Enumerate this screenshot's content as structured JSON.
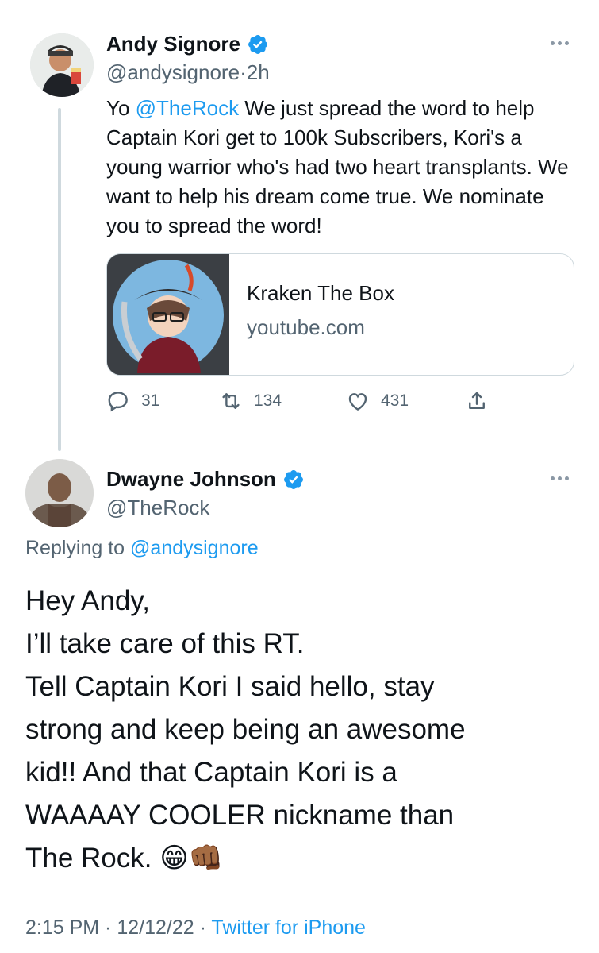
{
  "tweet1": {
    "display_name": "Andy Signore",
    "handle": "@andysignore",
    "separator": "·",
    "time": "2h",
    "text_parts": {
      "prefix": "Yo ",
      "mention": "@TheRock",
      "rest": " We just spread the word to help  Captain Kori get to 100k Subscribers, Kori's a young warrior who's had two heart transplants. We want to help his dream come true. We nominate you to spread the word!"
    },
    "card": {
      "title": "Kraken The Box",
      "domain": "youtube.com"
    },
    "actions": {
      "replies": "31",
      "retweets": "134",
      "likes": "431"
    }
  },
  "tweet2": {
    "display_name": "Dwayne Johnson",
    "handle": "@TheRock",
    "replying_prefix": "Replying to ",
    "replying_handle": "@andysignore",
    "lines": [
      "Hey Andy,",
      "I’ll take care of this RT.",
      "Tell Captain Kori I said hello, stay",
      "strong and keep being an awesome",
      "kid!! And that Captain Kori is a",
      "WAAAAY COOLER nickname than",
      "The Rock. 😁👊🏾"
    ],
    "footer": {
      "time": "2:15 PM",
      "sep1": " · ",
      "date": "12/12/22",
      "sep2": " · ",
      "source": "Twitter for iPhone"
    }
  },
  "colors": {
    "accent": "#1d9bf0",
    "text": "#0f1419",
    "muted": "#536471",
    "border": "#cfd9de"
  }
}
